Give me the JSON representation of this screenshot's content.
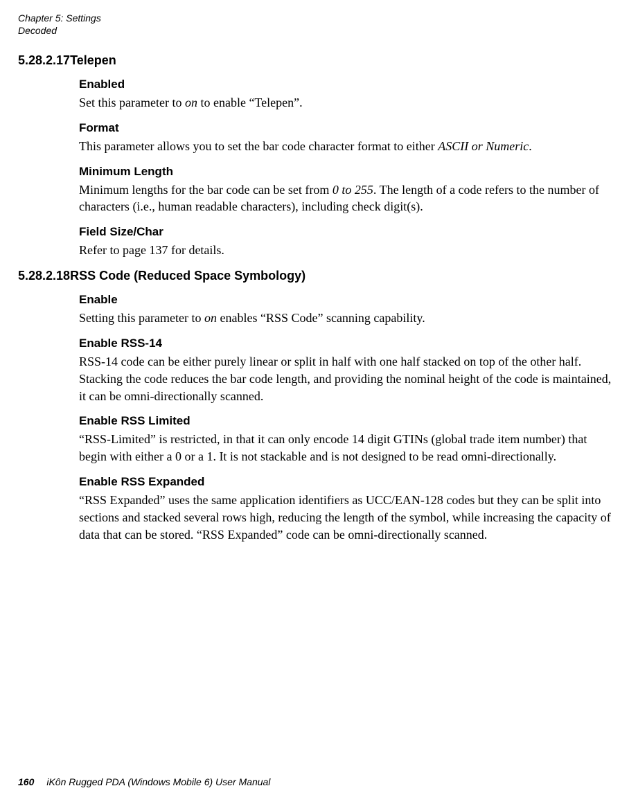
{
  "running_head": {
    "line1": "Chapter 5: Settings",
    "line2": "Decoded"
  },
  "sections": [
    {
      "number": "5.28.2.17",
      "title": "Telepen",
      "items": [
        {
          "heading": "Enabled",
          "html": "Set this parameter to <em>on</em> to enable “Telepen”."
        },
        {
          "heading": "Format",
          "html": "This parameter allows you to set the bar code character format to either <em>ASCII or Numeric</em>."
        },
        {
          "heading": "Minimum Length",
          "html": "Minimum lengths for the bar code can be set from <em>0 to 255</em>. The length of a code refers to the number of characters (i.e., human readable characters), including check digit(s)."
        },
        {
          "heading": "Field Size/Char",
          "html": "Refer to page 137 for details."
        }
      ]
    },
    {
      "number": "5.28.2.18",
      "title": "RSS Code (Reduced Space Symbology)",
      "items": [
        {
          "heading": "Enable",
          "html": "Setting this parameter to <em>on</em> enables “RSS Code” scanning capability."
        },
        {
          "heading": "Enable RSS-14",
          "html": "RSS-14 code can be either purely linear or split in half with one half stacked on top of the other half. Stacking the code reduces the bar code length, and providing the nominal height of the code is maintained, it can be omni-directionally scanned."
        },
        {
          "heading": "Enable RSS Limited",
          "html": "“RSS-Limited” is restricted, in that it can only encode 14 digit GTINs (global trade item number) that begin with either a 0 or a 1. It is not stackable and is not designed to be read omni-directionally."
        },
        {
          "heading": "Enable RSS Expanded",
          "html": "“RSS Expanded” uses the same application identifiers as UCC/EAN-128 codes but they can be split into sections and stacked several rows high, reducing the length of the symbol, while increasing the capacity of data that can be stored. “RSS Expanded” code can be omni-directionally scanned."
        }
      ]
    }
  ],
  "footer": {
    "page_number": "160",
    "book_title": "iKôn Rugged PDA (Windows Mobile 6) User Manual"
  }
}
